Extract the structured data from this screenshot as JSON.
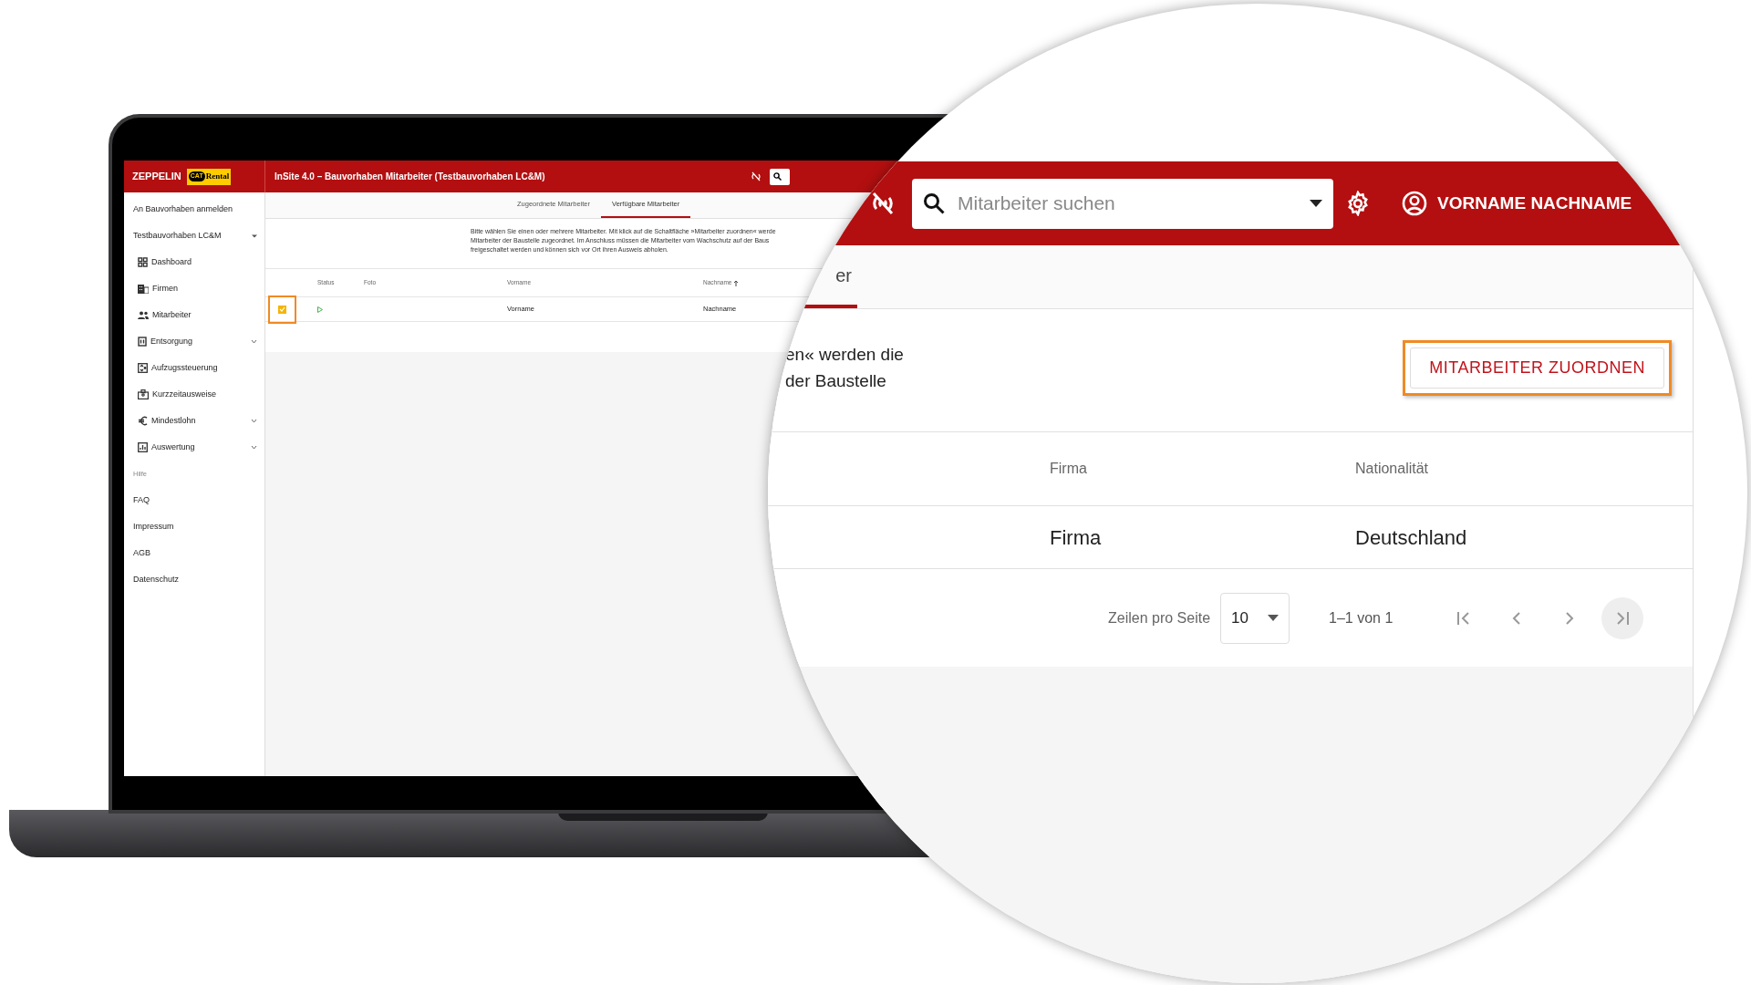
{
  "laptop": {
    "logo": {
      "brand": "ZEPPELIN",
      "badge_mark": "CAT",
      "badge_text": "Rental"
    },
    "title": "InSite 4.0 – Bauvorhaben Mitarbeiter (Testbauvorhaben LC&M)",
    "sidebar": [
      {
        "kind": "link",
        "label": "An Bauvorhaben anmelden"
      },
      {
        "kind": "group",
        "label": "Testbauvorhaben LC&M",
        "expanded": true
      },
      {
        "kind": "nav",
        "label": "Dashboard"
      },
      {
        "kind": "nav",
        "label": "Firmen"
      },
      {
        "kind": "nav",
        "label": "Mitarbeiter"
      },
      {
        "kind": "nav-menu",
        "label": "Entsorgung",
        "expanded": false
      },
      {
        "kind": "nav",
        "label": "Aufzugssteuerung"
      },
      {
        "kind": "nav",
        "label": "Kurzzeitausweise"
      },
      {
        "kind": "nav-menu",
        "label": "Mindestlohn",
        "expanded": false
      },
      {
        "kind": "nav-menu",
        "label": "Auswertung",
        "expanded": false
      },
      {
        "kind": "section",
        "label": "Hilfe"
      },
      {
        "kind": "link",
        "label": "FAQ"
      },
      {
        "kind": "link",
        "label": "Impressum"
      },
      {
        "kind": "link",
        "label": "AGB"
      },
      {
        "kind": "link",
        "label": "Datenschutz"
      }
    ],
    "tabs": [
      {
        "label": "Zugeordnete Mitarbeiter",
        "selected": false
      },
      {
        "label": "Verfügbare Mitarbeiter",
        "selected": true
      }
    ],
    "description_lines": [
      "Bitte wählen Sie einen oder mehrere Mitarbeiter. Mit klick auf die Schaltfläche »Mitarbeiter zuordnen« werde",
      "Mitarbeiter der Baustelle zugeordnet. Im Anschluss müssen die Mitarbeiter vom Wachschutz auf der Baus",
      "freigeschaltet werden und können sich vor Ort ihren Ausweis abholen."
    ],
    "table": {
      "columns": [
        {
          "label": "Status",
          "sorted": false
        },
        {
          "label": "Foto",
          "sorted": false
        },
        {
          "label": "Vorname",
          "sorted": false
        },
        {
          "label": "Nachname",
          "sorted": true
        }
      ],
      "rows": [
        {
          "selected": true,
          "vorname": "Vorname",
          "nachname": "Nachname"
        }
      ]
    }
  },
  "magnifier": {
    "search": {
      "placeholder": "Mitarbeiter suchen"
    },
    "user_name": "VORNAME NACHNAME",
    "tab": {
      "label": "er",
      "selected": true
    },
    "description_lines": [
      "en« werden die",
      "der Baustelle"
    ],
    "assign_button": "MITARBEITER ZUORDNEN",
    "table": {
      "columns": [
        "Firma",
        "Nationalität"
      ],
      "rows": [
        [
          "Firma",
          "Deutschland"
        ]
      ]
    },
    "pagination": {
      "rows_per_page_label": "Zeilen pro Seite",
      "rows_per_page": "10",
      "range": "1–1 von 1"
    }
  }
}
